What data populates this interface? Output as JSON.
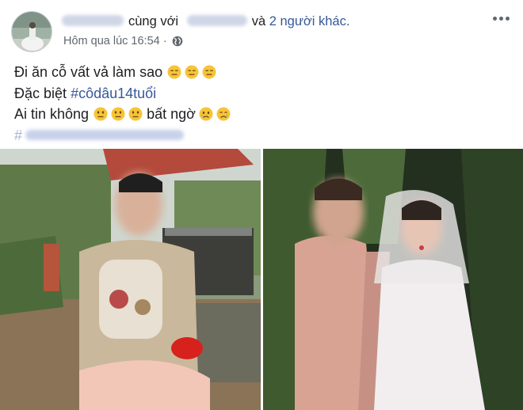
{
  "header": {
    "with_text": "cùng với",
    "and_text": "và",
    "others_link": "2 người khác.",
    "timestamp": "Hôm qua lúc 16:54 ·",
    "privacy_icon": "globe-icon",
    "menu_icon": "more-dots-icon"
  },
  "post": {
    "line1_text": "Đi ăn cỗ vất vả làm sao",
    "line1_emojis": [
      "expressionless-emoji",
      "expressionless-emoji",
      "expressionless-emoji"
    ],
    "line2_text": "Đặc biệt",
    "line2_hashtag": "#côdâu14tuổi",
    "line3_text_a": "Ai tin không",
    "line3_emojis_a": [
      "neutral-emoji",
      "neutral-emoji",
      "neutral-emoji"
    ],
    "line3_text_b": "bất ngờ",
    "line3_emojis_b": [
      "sad-emoji",
      "crying-emoji"
    ],
    "line4_hash_prefix": "#"
  },
  "colors": {
    "link": "#385898",
    "meta": "#606770",
    "text": "#1c1e21"
  }
}
